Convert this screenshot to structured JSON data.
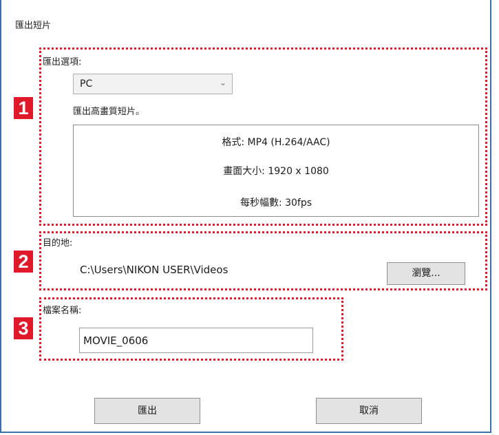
{
  "dialog": {
    "title": "匯出短片"
  },
  "export_options": {
    "badge": "1",
    "label": "匯出選項:",
    "selected": "PC",
    "description": "匯出高畫質短片。",
    "format": "格式: MP4 (H.264/AAC)",
    "frame_size": "畫面大小: 1920 x 1080",
    "frame_rate": "每秒幅數: 30fps"
  },
  "destination": {
    "badge": "2",
    "label": "目的地:",
    "path": "C:\\Users\\NIKON USER\\Videos",
    "browse_label": "瀏覽..."
  },
  "file_name": {
    "badge": "3",
    "label": "檔案名稱:",
    "value": "MOVIE_0606"
  },
  "footer": {
    "export_label": "匯出",
    "cancel_label": "取消"
  },
  "colors": {
    "highlight": "#e0192a",
    "window_border": "#3b6fb0"
  },
  "icons": {
    "dropdown": "chevron-down-icon"
  }
}
